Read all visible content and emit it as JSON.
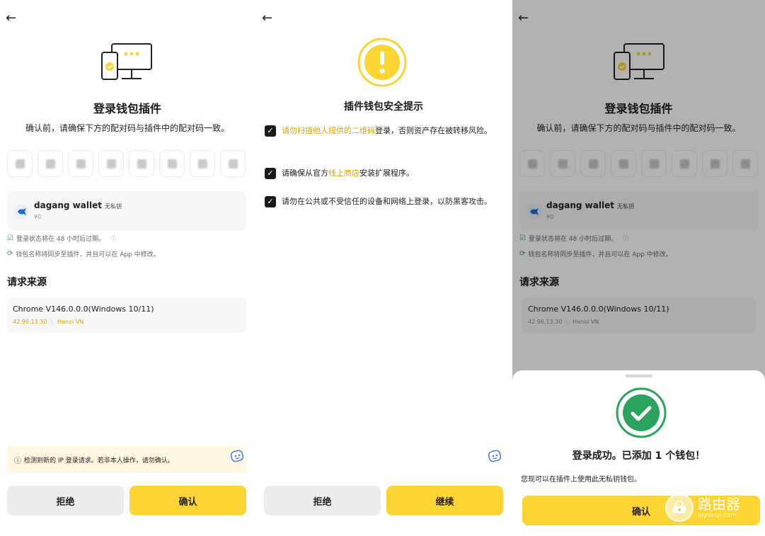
{
  "login": {
    "back_icon": "arrow-left-icon",
    "title": "登录钱包插件",
    "subtitle": "确认前，请确保下方的配对码与插件中的配对码一致。",
    "pair_code_count": 8,
    "wallet": {
      "name": "dagang wallet",
      "tag": "无私钥",
      "balance": "¥0"
    },
    "notes": [
      {
        "icon": "shield-check-icon",
        "text": "登录状态将在 48 小时后过期。"
      },
      {
        "icon": "sync-icon",
        "text": "钱包名称将同步至插件，并且可以在 App 中修改。"
      }
    ],
    "source_heading": "请求来源",
    "source": {
      "browser": "Chrome V146.0.0.0(Windows 10/11)",
      "ip": "42.96.13.30",
      "location": "Hanoi VN"
    },
    "alert": "检测到新的 IP 登录请求。若非本人操作，请勿确认。",
    "reject_label": "拒绝",
    "confirm_label": "确认"
  },
  "security": {
    "back_icon": "arrow-left-icon",
    "title": "插件钱包安全提示",
    "items": [
      {
        "pre": "",
        "highlight": "请勿扫描他人提供的二维码",
        "post": "登录，否则资产存在被转移风险。"
      },
      {
        "pre": "请确保从官方",
        "highlight": "线上商店",
        "post": "安装扩展程序。"
      },
      {
        "pre": "请勿在公共或不受信任的设备和网络上登录，以防黑客攻击。",
        "highlight": "",
        "post": ""
      }
    ],
    "reject_label": "拒绝",
    "continue_label": "继续"
  },
  "success": {
    "title": "登录成功。已添加 1 个钱包！",
    "description": "您现可以在插件上使用此无私钥钱包。",
    "confirm_label": "确认"
  },
  "watermark": {
    "text": "路由器",
    "sub": "luyouqi.com"
  },
  "colors": {
    "accent": "#fcd535",
    "highlight": "#e0a200",
    "success": "#2ba35c"
  }
}
